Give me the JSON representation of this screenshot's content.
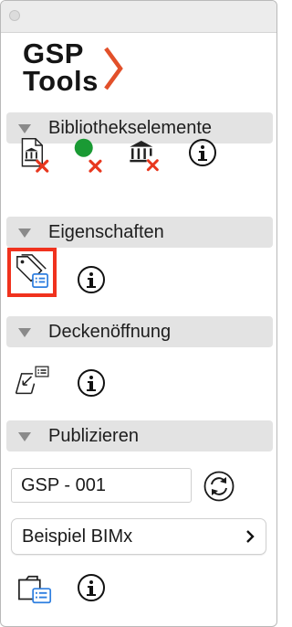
{
  "logo": {
    "line1": "GSP",
    "line2": "Tools",
    "accent_color": "#e2502a"
  },
  "sections": {
    "bibliothek": {
      "title": "Bibliothekselemente",
      "tools": [
        "library-remove-icon",
        "green-dot-remove-icon",
        "building-remove-icon",
        "info-icon"
      ]
    },
    "eigenschaften": {
      "title": "Eigenschaften",
      "tools": [
        "tags-list-icon",
        "info-icon"
      ],
      "highlight_color": "#f0321e"
    },
    "deckenoeffnung": {
      "title": "Deckenöffnung",
      "tools": [
        "ceiling-opening-icon",
        "info-icon"
      ]
    },
    "publizieren": {
      "title": "Publizieren",
      "name_field_value": "GSP - 001",
      "dropdown_value": "Beispiel BIMx",
      "tools": [
        "refresh-icon",
        "publish-list-icon",
        "info-icon"
      ]
    }
  },
  "colors": {
    "header_bg": "#e3e3e3",
    "red_x": "#e8371e",
    "green": "#1a9a34",
    "blue": "#2f7fe0"
  }
}
